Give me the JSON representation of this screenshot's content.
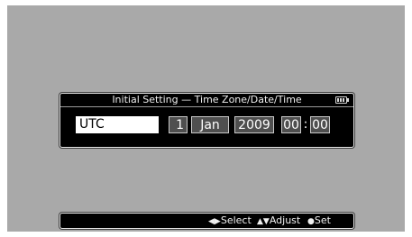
{
  "dialog": {
    "title": "Initial Setting — Time Zone/Date/Time",
    "time_zone": "UTC",
    "day": "1",
    "month": "Jan",
    "year": "2009",
    "hour": "00",
    "separator": ":",
    "minute": "00"
  },
  "icons": {
    "battery": "battery-icon",
    "select": "left-right-arrows-icon",
    "adjust": "up-down-arrows-icon",
    "set": "dot-icon"
  },
  "footer": {
    "select_glyph": "◀▶",
    "select_label": "Select",
    "adjust_glyph": "▲▼",
    "adjust_label": "Adjust",
    "set_glyph": "●",
    "set_label": "Set"
  },
  "colors": {
    "screen_background": "#a9a9a9",
    "panel_background": "#000000",
    "field_background": "#4f4f4f",
    "selected_field": "#ffffff"
  }
}
